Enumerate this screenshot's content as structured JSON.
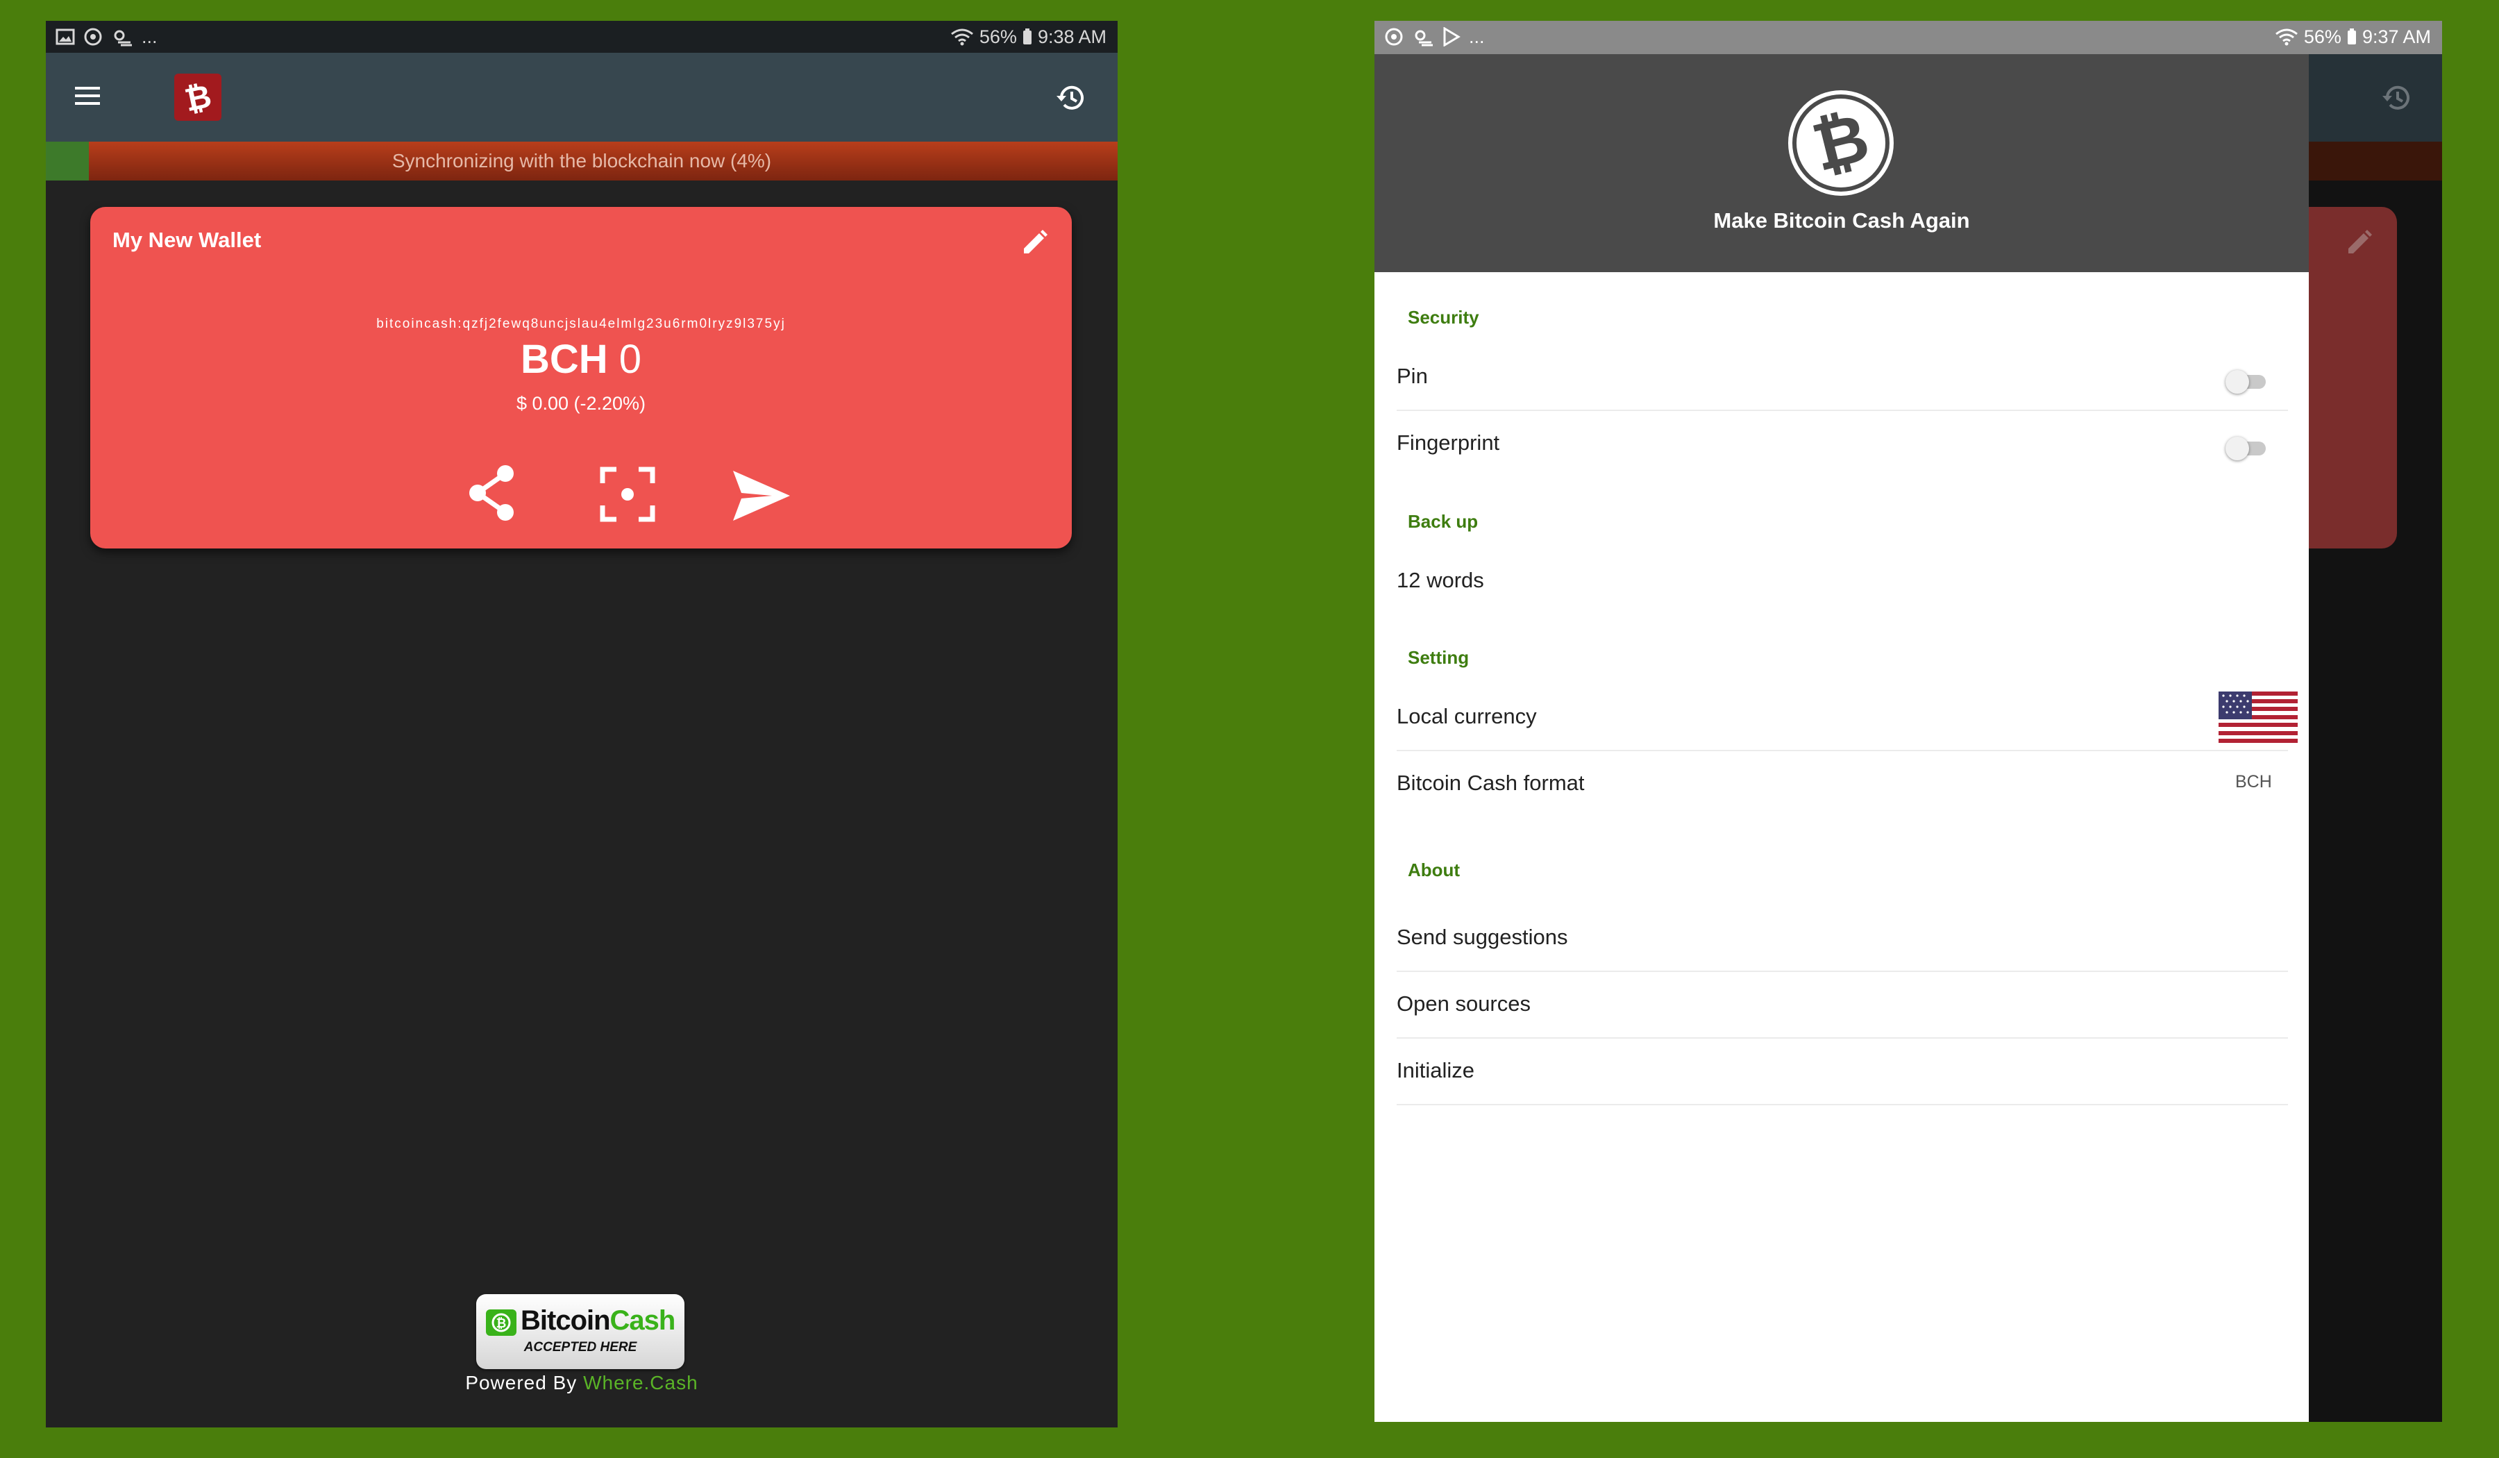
{
  "left": {
    "status": {
      "battery": "56%",
      "time": "9:38 AM",
      "more": "..."
    },
    "sync_text": "Synchronizing with the blockchain now (4%)",
    "sync_progress": 0.04,
    "wallet": {
      "name": "My New Wallet",
      "address": "bitcoincash:qzfj2fewq8uncjslau4elmlg23u6rm0lryz9l375yj",
      "balance_unit": "BCH",
      "balance_value": "0",
      "fiat": "$ 0.00 (-2.20%)"
    },
    "badge": {
      "brand_prefix": "Bitcoin",
      "brand_suffix": "Cash",
      "tagline": "ACCEPTED HERE",
      "powered_prefix": "Powered By ",
      "powered_link": "Where.Cash"
    },
    "icons": [
      "menu-icon",
      "bitcoin-cash-logo-icon",
      "history-icon",
      "edit-icon",
      "share-icon",
      "scan-icon",
      "send-icon"
    ]
  },
  "right": {
    "status": {
      "battery": "56%",
      "time": "9:37 AM",
      "more": "..."
    },
    "drawer": {
      "title": "Make Bitcoin Cash Again",
      "security": {
        "label": "Security",
        "pin": {
          "label": "Pin",
          "enabled": false
        },
        "fingerprint": {
          "label": "Fingerprint",
          "enabled": false
        }
      },
      "backup": {
        "label": "Back up",
        "words": "12 words"
      },
      "setting": {
        "label": "Setting",
        "local_currency": "Local currency",
        "local_currency_flag": "us-flag-icon",
        "format_label": "Bitcoin Cash format",
        "format_value": "BCH"
      },
      "about": {
        "label": "About",
        "items": [
          "Send suggestions",
          "Open sources",
          "Initialize"
        ]
      }
    }
  },
  "colors": {
    "background": "#4a7e0c",
    "card": "#ef5350",
    "appbar": "#37474f",
    "accent_green": "#3e7d10",
    "drawer_header": "#4a4a4a"
  }
}
